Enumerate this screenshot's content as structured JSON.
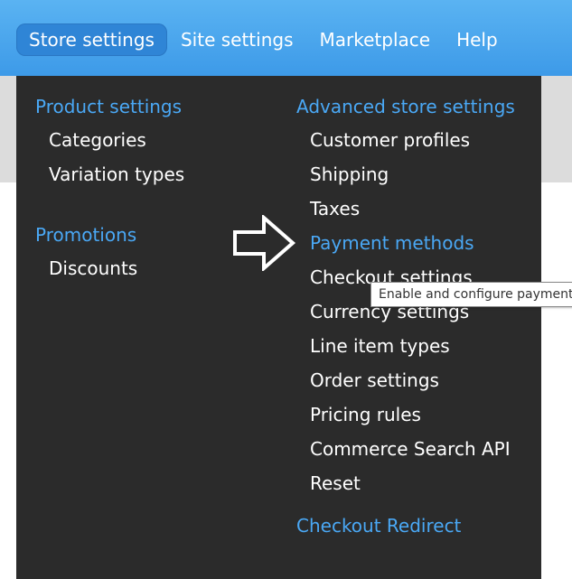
{
  "nav": {
    "items": [
      {
        "label": "Store settings",
        "active": true
      },
      {
        "label": "Site settings",
        "active": false
      },
      {
        "label": "Marketplace",
        "active": false
      },
      {
        "label": "Help",
        "active": false
      }
    ]
  },
  "dropdown": {
    "left": {
      "groups": [
        {
          "heading": "Product settings",
          "items": [
            "Categories",
            "Variation types"
          ]
        },
        {
          "heading": "Promotions",
          "items": [
            "Discounts"
          ]
        }
      ]
    },
    "right": {
      "groups": [
        {
          "heading": "Advanced store settings",
          "items": [
            "Customer profiles",
            "Shipping",
            "Taxes",
            "Payment methods",
            "Checkout settings",
            "Currency settings",
            "Line item types",
            "Order settings",
            "Pricing rules",
            "Commerce Search API",
            "Reset"
          ]
        },
        {
          "heading": "Checkout Redirect",
          "items": []
        }
      ]
    }
  },
  "tooltip": {
    "text": "Enable and configure payment methods"
  },
  "colors": {
    "topbar": "#4aa8f0",
    "active_tab": "#2f85d6",
    "dropdown_bg": "#2b2b2b",
    "link_blue": "#4aa8f5",
    "text_white": "#ffffff"
  },
  "icons": {
    "annotation": "right-arrow-outline-icon"
  }
}
